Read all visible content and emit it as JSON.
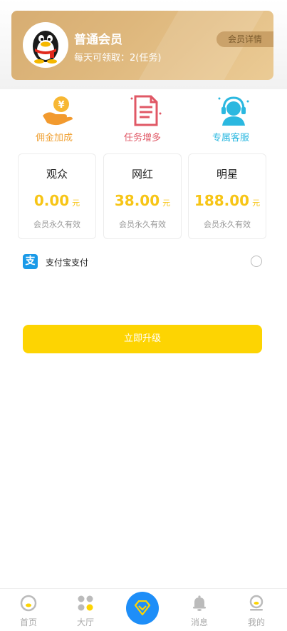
{
  "member": {
    "title": "普通会员",
    "daily": "每天可领取：2(任务)",
    "detail_label": "会员详情"
  },
  "benefits": [
    {
      "label": "佣金加成",
      "icon": "hand-coin-icon",
      "color": "#f0a236"
    },
    {
      "label": "任务增多",
      "icon": "document-icon",
      "color": "#e05866"
    },
    {
      "label": "专属客服",
      "icon": "customer-service-icon",
      "color": "#2bb8e0"
    }
  ],
  "plans": [
    {
      "name": "观众",
      "price": "0.00",
      "unit": "元",
      "validity": "会员永久有效"
    },
    {
      "name": "网红",
      "price": "38.00",
      "unit": "元",
      "validity": "会员永久有效"
    },
    {
      "name": "明星",
      "price": "188.00",
      "unit": "元",
      "validity": "会员永久有效"
    }
  ],
  "payment": {
    "icon_glyph": "支",
    "label": "支付宝支付"
  },
  "upgrade_label": "立即升级",
  "tabbar": [
    {
      "label": "首页",
      "icon": "home-icon"
    },
    {
      "label": "大厅",
      "icon": "hall-icon"
    },
    {
      "label": "",
      "icon": "diamond-icon"
    },
    {
      "label": "消息",
      "icon": "bell-icon"
    },
    {
      "label": "我的",
      "icon": "profile-icon"
    }
  ],
  "colors": {
    "accent_yellow": "#fdd402",
    "price_yellow": "#f7c516",
    "card_gold": "#d7ad72",
    "center_blue": "#1e8ef8"
  }
}
